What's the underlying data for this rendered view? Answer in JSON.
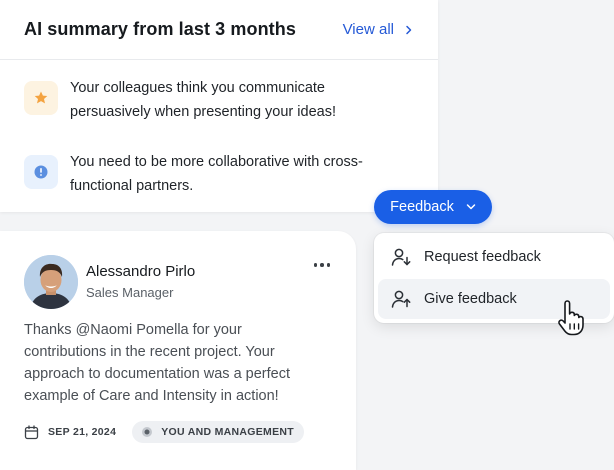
{
  "summary": {
    "title": "AI summary from last 3 months",
    "view_all_label": "View all",
    "insights": [
      {
        "icon": "star-icon",
        "text": "Your colleagues think you communicate persuasively when presenting your ideas!"
      },
      {
        "icon": "info-icon",
        "text": "You need to be more collaborative with cross-functional partners."
      }
    ]
  },
  "feedback_button": {
    "label": "Feedback"
  },
  "dropdown": {
    "items": [
      {
        "label": "Request feedback",
        "icon": "person-down-arrow-icon"
      },
      {
        "label": "Give feedback",
        "icon": "person-up-arrow-icon"
      }
    ]
  },
  "post": {
    "author_name": "Alessandro Pirlo",
    "author_role": "Sales Manager",
    "body": "Thanks @Naomi Pomella for your contributions in the recent project. Your approach to documentation was a perfect example of Care and Intensity in action!",
    "date": "SEP 21, 2024",
    "visibility": "YOU AND MANAGEMENT"
  },
  "colors": {
    "primary": "#1a5fe6",
    "link": "#2459d6",
    "star": "#f4a340",
    "info": "#5b8fe0"
  }
}
